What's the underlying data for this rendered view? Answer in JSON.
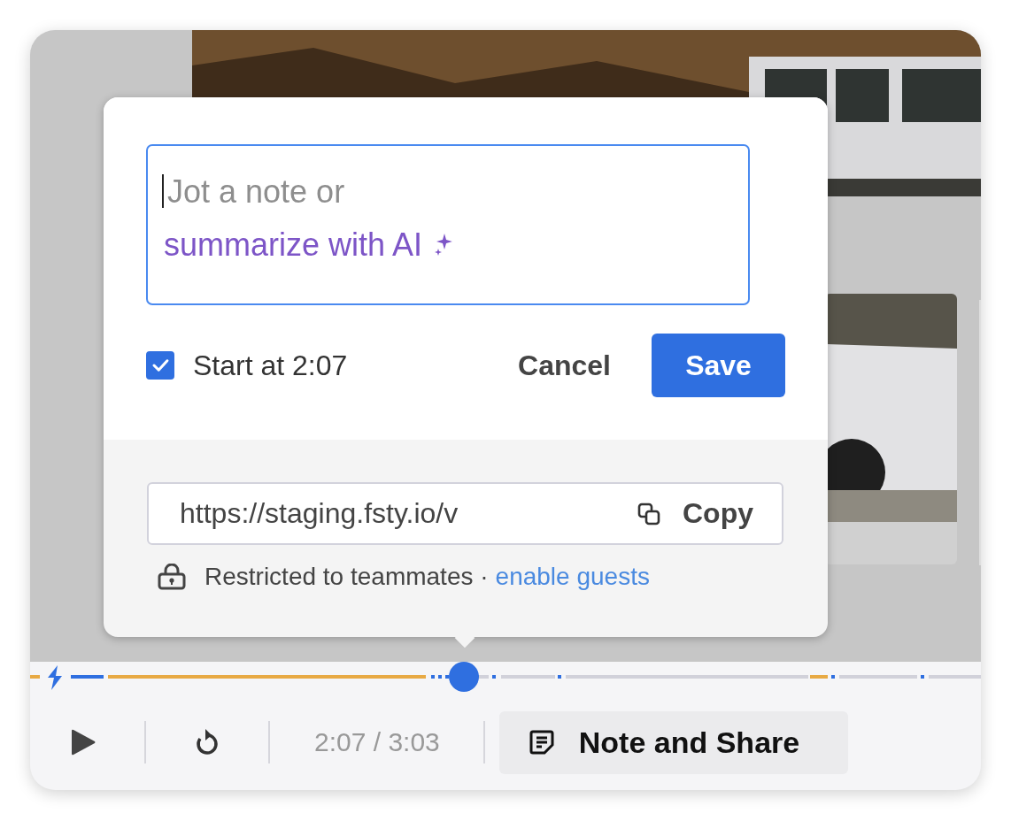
{
  "note_editor": {
    "placeholder": "Jot a note or",
    "ai_prompt": "summarize with AI",
    "start_at": {
      "label": "Start at 2:07",
      "checked": true
    },
    "cancel": "Cancel",
    "save": "Save"
  },
  "share": {
    "url": "https://staging.fsty.io/v",
    "copy": "Copy",
    "access_text": "Restricted to teammates ·",
    "access_link": "enable guests"
  },
  "player": {
    "progress": {
      "level": 0.456
    },
    "time": "2:07 / 3:03",
    "note_button": "Note and Share"
  }
}
